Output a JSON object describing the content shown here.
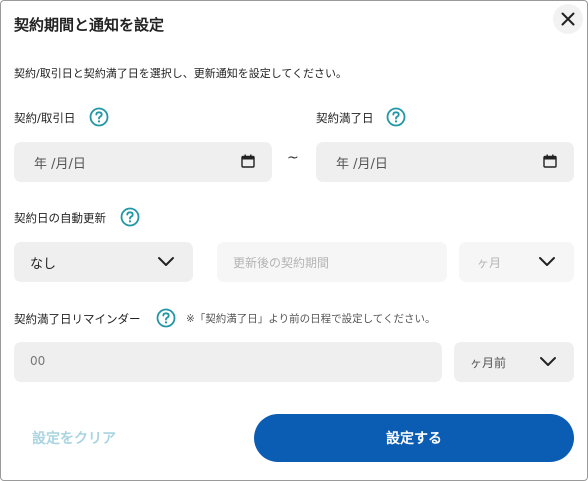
{
  "dialog": {
    "title": "契約期間と通知を設定",
    "description": "契約/取引日と契約満了日を選択し、更新通知を設定してください。"
  },
  "contract_date": {
    "label": "契約/取引日",
    "placeholder": "年 /月/日"
  },
  "range_separator": "~",
  "expiry_date": {
    "label": "契約満了日",
    "placeholder": "年 /月/日"
  },
  "auto_renewal": {
    "label": "契約日の自動更新",
    "selected": "なし",
    "period_placeholder": "更新後の契約期間",
    "unit": "ヶ月"
  },
  "reminder": {
    "label": "契約満了日リマインダー",
    "note": "※「契約満了日」より前の日程で設定してください。",
    "value_placeholder": "00",
    "unit": "ヶ月前"
  },
  "actions": {
    "clear_label": "設定をクリア",
    "submit_label": "設定する"
  },
  "colors": {
    "primary": "#0a5db3",
    "help_icon": "#2196a6",
    "clear_text": "#a9d4e0",
    "field_bg": "#efefef"
  }
}
